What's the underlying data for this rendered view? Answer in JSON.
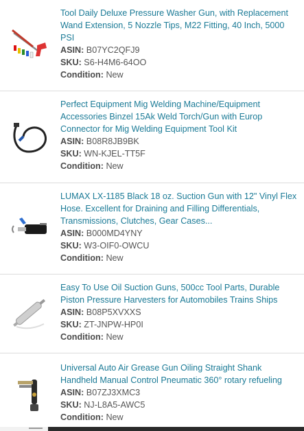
{
  "products": [
    {
      "title": "Tool Daily Deluxe Pressure Washer Gun, with Replacement Wand Extension, 5 Nozzle Tips, M22 Fitting, 40 Inch, 5000 PSI",
      "asin_label": "ASIN:",
      "asin": "B07YC2QFJ9",
      "sku_label": "SKU:",
      "sku": "S6-H4M6-64OO",
      "condition_label": "Condition:",
      "condition": "New",
      "image_icon": "pressure-washer-gun-icon"
    },
    {
      "title": "Perfect Equipment Mig Welding Machine/Equipment Accessories Binzel 15Ak Weld Torch/Gun with Europ Connector for Mig Welding Equipment Tool Kit",
      "asin_label": "ASIN:",
      "asin": "B08R8JB9BK",
      "sku_label": "SKU:",
      "sku": "WN-KJEL-TT5F",
      "condition_label": "Condition:",
      "condition": "New",
      "image_icon": "welding-torch-icon"
    },
    {
      "title": "LUMAX LX-1185 Black 18 oz. Suction Gun with 12\" Vinyl Flex Hose. Excellent for Draining and Filling Differentials, Transmissions, Clutches, Gear Cases...",
      "asin_label": "ASIN:",
      "asin": "B000MD4YNY",
      "sku_label": "SKU:",
      "sku": "W3-OIF0-OWCU",
      "condition_label": "Condition:",
      "condition": "New",
      "image_icon": "suction-gun-icon"
    },
    {
      "title": "Easy To Use Oil Suction Guns, 500cc Tool Parts, Durable Piston Pressure Harvesters for Automobiles Trains Ships",
      "asin_label": "ASIN:",
      "asin": "B08P5XVXXS",
      "sku_label": "SKU:",
      "sku": "ZT-JNPW-HP0I",
      "condition_label": "Condition:",
      "condition": "New",
      "image_icon": "oil-suction-gun-icon"
    },
    {
      "title": "Universal Auto Air Grease Gun Oiling Straight Shank Handheld Manual Control Pneumatic 360° rotary refueling",
      "asin_label": "ASIN:",
      "asin": "B07ZJ3XMC3",
      "sku_label": "SKU:",
      "sku": "NJ-L8A5-AWC5",
      "condition_label": "Condition:",
      "condition": "New",
      "image_icon": "grease-gun-icon"
    }
  ]
}
